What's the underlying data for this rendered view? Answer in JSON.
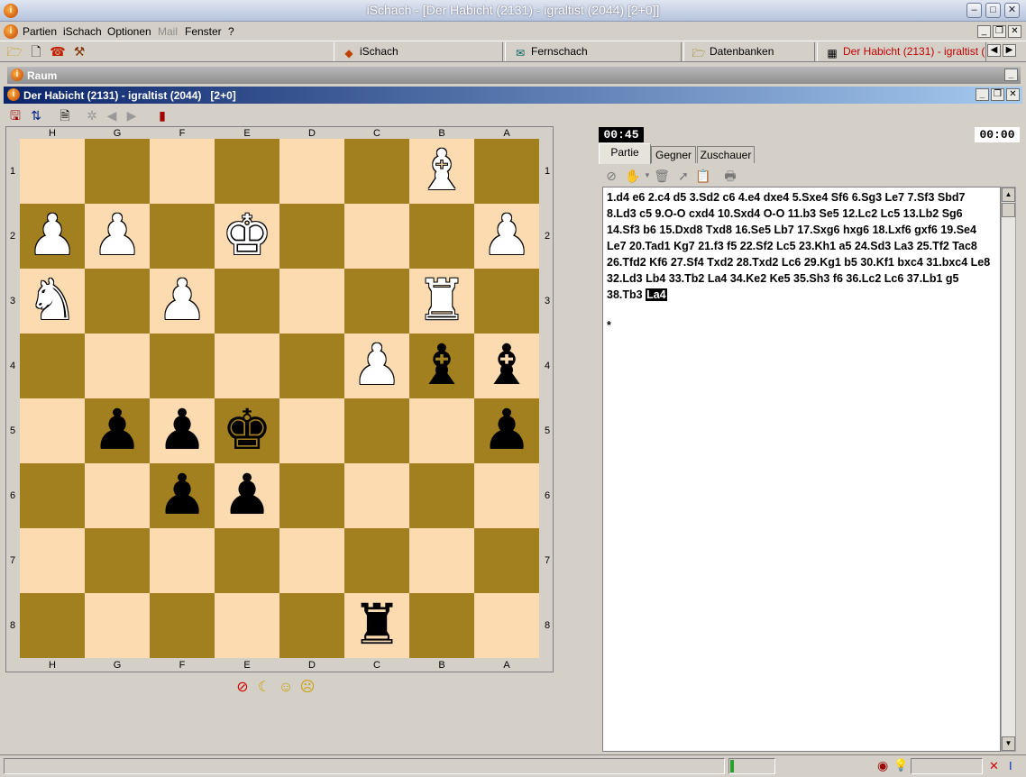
{
  "window": {
    "title": "iSchach - [Der Habicht (2131) - igraltist (2044)   [2+0]]"
  },
  "menu": [
    "Partien",
    "iSchach",
    "Optionen",
    "Mail",
    "Fenster",
    "?"
  ],
  "menu_disabled": [
    false,
    false,
    false,
    true,
    false,
    false
  ],
  "toolbar_tabs": [
    {
      "label": "iSchach",
      "icon": "ischach-icon"
    },
    {
      "label": "Fernschach",
      "icon": "correspondence-icon"
    },
    {
      "label": "Datenbanken",
      "icon": "database-icon"
    },
    {
      "label": "Der Habicht (2131) - igraltist (2044)",
      "icon": "chessboard-icon"
    }
  ],
  "raum": {
    "title": "Raum"
  },
  "game_window": {
    "title": "Der Habicht (2131) - igraltist (2044)   [2+0]"
  },
  "board": {
    "files": [
      "H",
      "G",
      "F",
      "E",
      "D",
      "C",
      "B",
      "A"
    ],
    "ranks": [
      "1",
      "2",
      "3",
      "4",
      "5",
      "6",
      "7",
      "8"
    ],
    "pieces": [
      {
        "square": "b1",
        "piece": "bishop",
        "color": "white",
        "glyph": "♝"
      },
      {
        "square": "h2",
        "piece": "pawn",
        "color": "white",
        "glyph": "♟"
      },
      {
        "square": "g2",
        "piece": "pawn",
        "color": "white",
        "glyph": "♟"
      },
      {
        "square": "e2",
        "piece": "king",
        "color": "white",
        "glyph": "♚"
      },
      {
        "square": "a2",
        "piece": "pawn",
        "color": "white",
        "glyph": "♟"
      },
      {
        "square": "h3",
        "piece": "knight",
        "color": "white",
        "glyph": "♞"
      },
      {
        "square": "f3",
        "piece": "pawn",
        "color": "white",
        "glyph": "♟"
      },
      {
        "square": "b3",
        "piece": "rook",
        "color": "white",
        "glyph": "♜"
      },
      {
        "square": "c4",
        "piece": "pawn",
        "color": "white",
        "glyph": "♟"
      },
      {
        "square": "b4",
        "piece": "bishop",
        "color": "black",
        "glyph": "♝"
      },
      {
        "square": "a4",
        "piece": "bishop",
        "color": "black",
        "glyph": "♝"
      },
      {
        "square": "g5",
        "piece": "pawn",
        "color": "black",
        "glyph": "♟"
      },
      {
        "square": "f5",
        "piece": "pawn",
        "color": "black",
        "glyph": "♟"
      },
      {
        "square": "e5",
        "piece": "king",
        "color": "black",
        "glyph": "♚"
      },
      {
        "square": "a5",
        "piece": "pawn",
        "color": "black",
        "glyph": "♟"
      },
      {
        "square": "f6",
        "piece": "pawn",
        "color": "black",
        "glyph": "♟"
      },
      {
        "square": "e6",
        "piece": "pawn",
        "color": "black",
        "glyph": "♟"
      },
      {
        "square": "c8",
        "piece": "rook",
        "color": "black",
        "glyph": "♜"
      }
    ]
  },
  "clocks": {
    "left": "00:45",
    "right": "00:00"
  },
  "right_tabs": [
    "Partie",
    "Gegner",
    "Zuschauer"
  ],
  "notation": {
    "moves": "1.d4 e6 2.c4 d5 3.Sd2 c6 4.e4 dxe4 5.Sxe4 Sf6 6.Sg3 Le7 7.Sf3 Sbd7 8.Ld3 c5 9.O-O cxd4 10.Sxd4 O-O 11.b3 Se5 12.Lc2 Lc5 13.Lb2 Sg6 14.Sf3 b6 15.Dxd8 Txd8 16.Se5 Lb7 17.Sxg6 hxg6 18.Lxf6 gxf6 19.Se4 Le7 20.Tad1 Kg7 21.f3 f5 22.Sf2 Lc5 23.Kh1 a5 24.Sd3 La3 25.Tf2 Tac8 26.Tfd2 Kf6 27.Sf4 Txd2 28.Txd2 Lc6 29.Kg1 b5 30.Kf1 bxc4 31.bxc4 Le8 32.Ld3 Lb4 33.Tb2 La4 34.Ke2 Ke5 35.Sh3 f6 36.Lc2 Lc6 37.Lb1 g5 38.Tb3 ",
    "current_move": "La4",
    "result": "*"
  },
  "colors": {
    "light_square": "#fbdbaf",
    "dark_square": "#a2801f",
    "title_active": "#0a246a"
  }
}
